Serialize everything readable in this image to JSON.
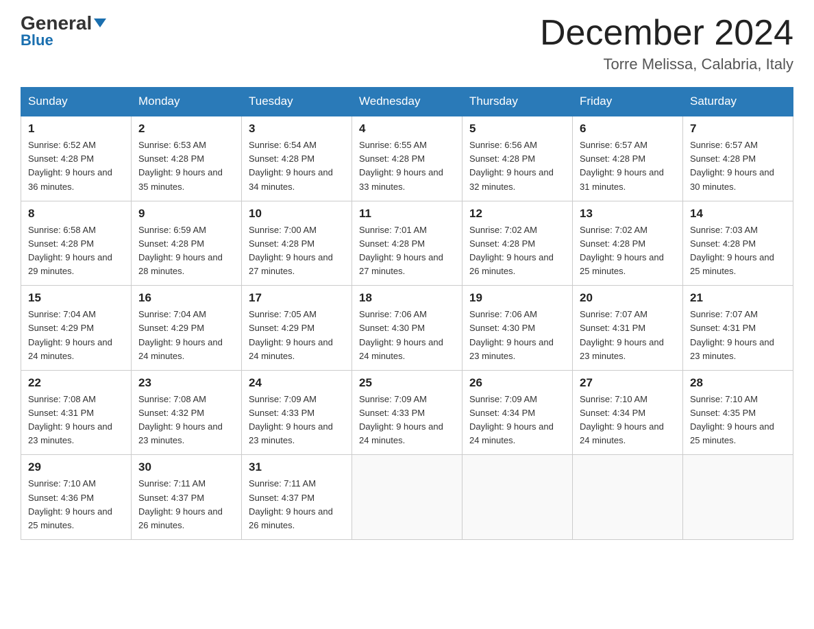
{
  "header": {
    "logo_general": "General",
    "logo_blue": "Blue",
    "month_title": "December 2024",
    "subtitle": "Torre Melissa, Calabria, Italy"
  },
  "days_of_week": [
    "Sunday",
    "Monday",
    "Tuesday",
    "Wednesday",
    "Thursday",
    "Friday",
    "Saturday"
  ],
  "weeks": [
    [
      {
        "day": "1",
        "sunrise": "6:52 AM",
        "sunset": "4:28 PM",
        "daylight": "9 hours and 36 minutes."
      },
      {
        "day": "2",
        "sunrise": "6:53 AM",
        "sunset": "4:28 PM",
        "daylight": "9 hours and 35 minutes."
      },
      {
        "day": "3",
        "sunrise": "6:54 AM",
        "sunset": "4:28 PM",
        "daylight": "9 hours and 34 minutes."
      },
      {
        "day": "4",
        "sunrise": "6:55 AM",
        "sunset": "4:28 PM",
        "daylight": "9 hours and 33 minutes."
      },
      {
        "day": "5",
        "sunrise": "6:56 AM",
        "sunset": "4:28 PM",
        "daylight": "9 hours and 32 minutes."
      },
      {
        "day": "6",
        "sunrise": "6:57 AM",
        "sunset": "4:28 PM",
        "daylight": "9 hours and 31 minutes."
      },
      {
        "day": "7",
        "sunrise": "6:57 AM",
        "sunset": "4:28 PM",
        "daylight": "9 hours and 30 minutes."
      }
    ],
    [
      {
        "day": "8",
        "sunrise": "6:58 AM",
        "sunset": "4:28 PM",
        "daylight": "9 hours and 29 minutes."
      },
      {
        "day": "9",
        "sunrise": "6:59 AM",
        "sunset": "4:28 PM",
        "daylight": "9 hours and 28 minutes."
      },
      {
        "day": "10",
        "sunrise": "7:00 AM",
        "sunset": "4:28 PM",
        "daylight": "9 hours and 27 minutes."
      },
      {
        "day": "11",
        "sunrise": "7:01 AM",
        "sunset": "4:28 PM",
        "daylight": "9 hours and 27 minutes."
      },
      {
        "day": "12",
        "sunrise": "7:02 AM",
        "sunset": "4:28 PM",
        "daylight": "9 hours and 26 minutes."
      },
      {
        "day": "13",
        "sunrise": "7:02 AM",
        "sunset": "4:28 PM",
        "daylight": "9 hours and 25 minutes."
      },
      {
        "day": "14",
        "sunrise": "7:03 AM",
        "sunset": "4:28 PM",
        "daylight": "9 hours and 25 minutes."
      }
    ],
    [
      {
        "day": "15",
        "sunrise": "7:04 AM",
        "sunset": "4:29 PM",
        "daylight": "9 hours and 24 minutes."
      },
      {
        "day": "16",
        "sunrise": "7:04 AM",
        "sunset": "4:29 PM",
        "daylight": "9 hours and 24 minutes."
      },
      {
        "day": "17",
        "sunrise": "7:05 AM",
        "sunset": "4:29 PM",
        "daylight": "9 hours and 24 minutes."
      },
      {
        "day": "18",
        "sunrise": "7:06 AM",
        "sunset": "4:30 PM",
        "daylight": "9 hours and 24 minutes."
      },
      {
        "day": "19",
        "sunrise": "7:06 AM",
        "sunset": "4:30 PM",
        "daylight": "9 hours and 23 minutes."
      },
      {
        "day": "20",
        "sunrise": "7:07 AM",
        "sunset": "4:31 PM",
        "daylight": "9 hours and 23 minutes."
      },
      {
        "day": "21",
        "sunrise": "7:07 AM",
        "sunset": "4:31 PM",
        "daylight": "9 hours and 23 minutes."
      }
    ],
    [
      {
        "day": "22",
        "sunrise": "7:08 AM",
        "sunset": "4:31 PM",
        "daylight": "9 hours and 23 minutes."
      },
      {
        "day": "23",
        "sunrise": "7:08 AM",
        "sunset": "4:32 PM",
        "daylight": "9 hours and 23 minutes."
      },
      {
        "day": "24",
        "sunrise": "7:09 AM",
        "sunset": "4:33 PM",
        "daylight": "9 hours and 23 minutes."
      },
      {
        "day": "25",
        "sunrise": "7:09 AM",
        "sunset": "4:33 PM",
        "daylight": "9 hours and 24 minutes."
      },
      {
        "day": "26",
        "sunrise": "7:09 AM",
        "sunset": "4:34 PM",
        "daylight": "9 hours and 24 minutes."
      },
      {
        "day": "27",
        "sunrise": "7:10 AM",
        "sunset": "4:34 PM",
        "daylight": "9 hours and 24 minutes."
      },
      {
        "day": "28",
        "sunrise": "7:10 AM",
        "sunset": "4:35 PM",
        "daylight": "9 hours and 25 minutes."
      }
    ],
    [
      {
        "day": "29",
        "sunrise": "7:10 AM",
        "sunset": "4:36 PM",
        "daylight": "9 hours and 25 minutes."
      },
      {
        "day": "30",
        "sunrise": "7:11 AM",
        "sunset": "4:37 PM",
        "daylight": "9 hours and 26 minutes."
      },
      {
        "day": "31",
        "sunrise": "7:11 AM",
        "sunset": "4:37 PM",
        "daylight": "9 hours and 26 minutes."
      },
      null,
      null,
      null,
      null
    ]
  ]
}
